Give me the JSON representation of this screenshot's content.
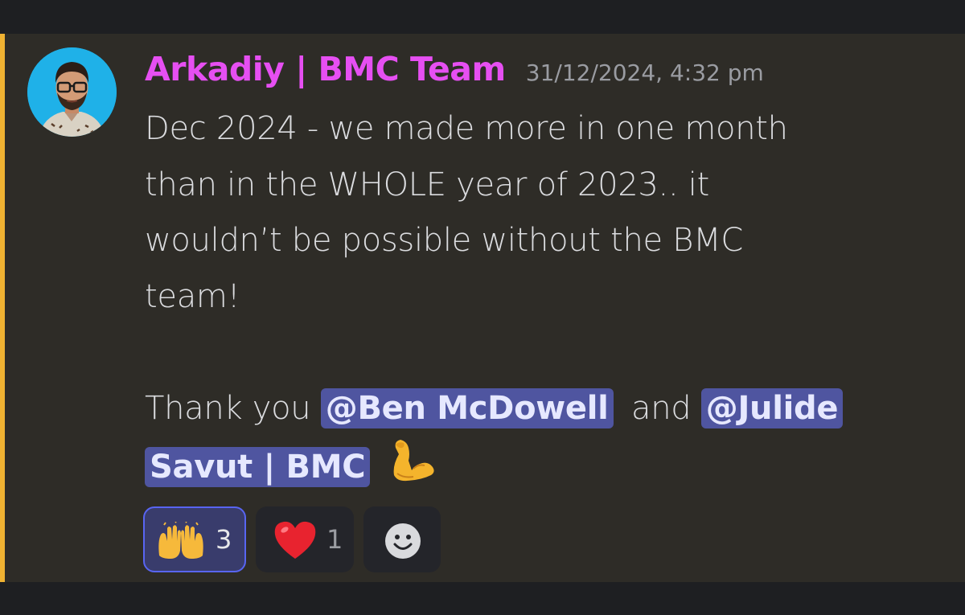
{
  "message": {
    "author": "Arkadiy | BMC Team",
    "timestamp": "31/12/2024, 4:32 pm",
    "lines": [
      "Dec 2024 - we made more in one month",
      "than in the WHOLE year of 2023.. it",
      "wouldn’t be possible without the BMC",
      "team!"
    ],
    "thanks_prefix": "Thank you ",
    "mention_1": "@Ben McDowell",
    "thanks_and": " and ",
    "mention_2_part1": "@Julide",
    "mention_2_part2": "Savut | BMC",
    "trailing_emoji": "flexed-biceps"
  },
  "reactions": [
    {
      "emoji": "raising-hands",
      "count": "3",
      "active": true
    },
    {
      "emoji": "red-heart",
      "count": "1",
      "active": false
    },
    {
      "emoji": "add-reaction",
      "count": "",
      "active": false
    }
  ],
  "colors": {
    "author": "#e64ff2",
    "mention_bg": "#4f55a0",
    "accent": "#f0b232",
    "message_bg": "#2e2c27"
  }
}
